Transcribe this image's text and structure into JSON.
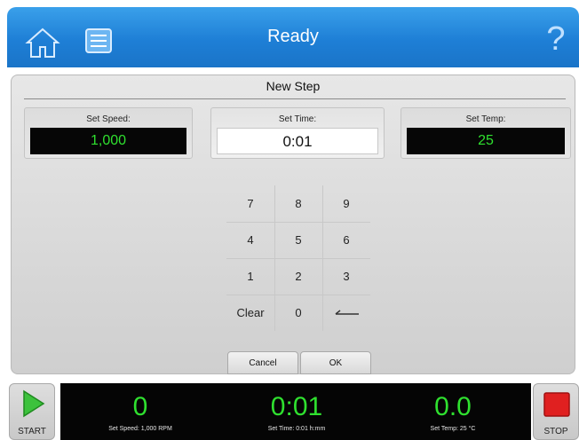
{
  "header": {
    "title": "Ready",
    "help_symbol": "?",
    "home_icon": "home-icon",
    "list_icon": "list-icon",
    "accent_color": "#1e7fd6"
  },
  "dialog": {
    "title": "New Step",
    "fields": [
      {
        "label": "Set Speed:",
        "value": "1,000"
      },
      {
        "label": "Set Time:",
        "value": "0:01"
      },
      {
        "label": "Set Temp:",
        "value": "25"
      }
    ],
    "value_color": "#2fe02f"
  },
  "keypad": {
    "keys": [
      "7",
      "8",
      "9",
      "4",
      "5",
      "6",
      "1",
      "2",
      "3",
      "Clear",
      "0",
      "⟵"
    ],
    "backspace_icon": "backspace-icon"
  },
  "actions": {
    "cancel_label": "Cancel",
    "ok_label": "OK"
  },
  "footer": {
    "start_label": "START",
    "stop_label": "STOP",
    "status": [
      {
        "value": "0",
        "label": "Set Speed: 1,000 RPM"
      },
      {
        "value": "0:01",
        "label": "Set Time: 0:01 h:mm"
      },
      {
        "value": "0.0",
        "label": "Set Temp: 25 °C"
      }
    ],
    "start_color": "#3cc23c",
    "stop_color": "#e02020"
  }
}
